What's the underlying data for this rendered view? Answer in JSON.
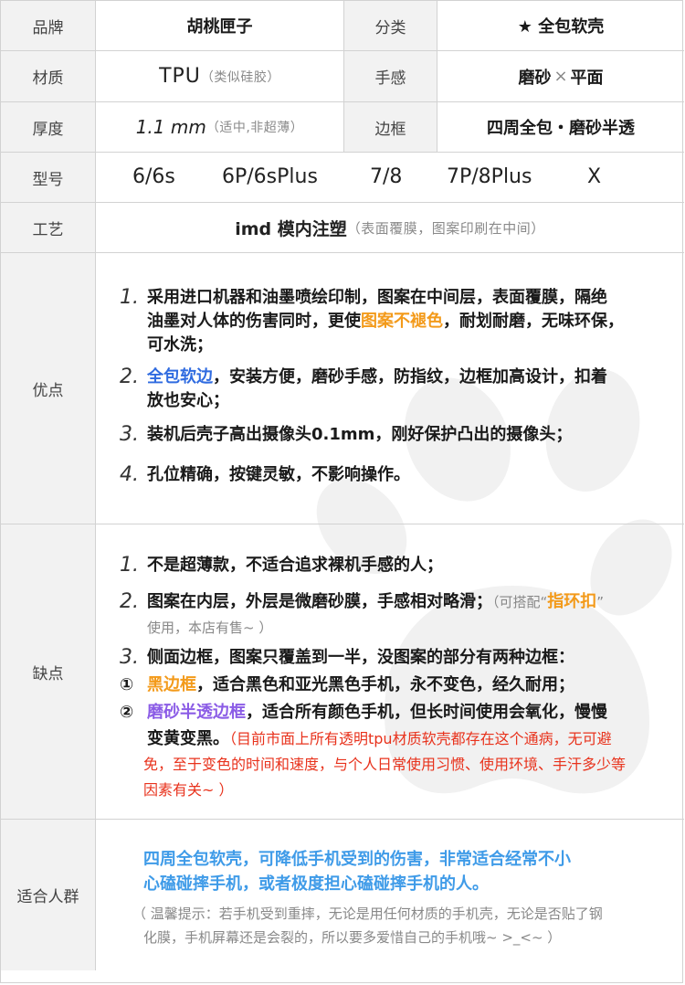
{
  "spec": {
    "brand": {
      "label": "品牌",
      "value": "胡桃匣子"
    },
    "category": {
      "label": "分类",
      "value": "★ 全包软壳"
    },
    "material": {
      "label": "材质",
      "value": "TPU",
      "note": "（类似硅胶）"
    },
    "feel": {
      "label": "手感",
      "value_a": "磨砂",
      "value_sep": "×",
      "value_b": "平面"
    },
    "thickness": {
      "label": "厚度",
      "value": "1.1 mm",
      "note": "（适中,非超薄）"
    },
    "frame": {
      "label": "边框",
      "value": "四周全包・磨砂半透"
    },
    "model": {
      "label": "型号",
      "items": [
        "6/6s",
        "6P/6sPlus",
        "7/8",
        "7P/8Plus",
        "X"
      ]
    },
    "craft": {
      "label": "工艺",
      "value": "imd 模内注塑",
      "note": "（表面覆膜，图案印刷在中间）"
    }
  },
  "pros": {
    "label": "优点",
    "items": [
      {
        "num": "1.",
        "l1": "采用进口机器和油墨喷绘印制，图案在中间层，表面覆膜，隔绝",
        "l2a": "油墨对人体的伤害同时，更使",
        "l2b": "图案不褪色",
        "l2c": "，耐划耐磨，无味环保，",
        "l3": "可水洗；"
      },
      {
        "num": "2.",
        "l1a": "全包软边",
        "l1b": "，安装方便，磨砂手感，防指纹，边框加高设计，扣着",
        "l2": "放也安心；"
      },
      {
        "num": "3.",
        "l1": "装机后壳子高出摄像头0.1mm，刚好保护凸出的摄像头；"
      },
      {
        "num": "4.",
        "l1": "孔位精确，按键灵敏，不影响操作。"
      }
    ]
  },
  "cons": {
    "label": "缺点",
    "item1": {
      "num": "1.",
      "text": "不是超薄款，不适合追求裸机手感的人；"
    },
    "item2": {
      "num": "2.",
      "text": "图案在内层，外层是微磨砂膜，手感相对略滑；",
      "note_a": "（可搭配“",
      "note_b": "指环扣",
      "note_c": "”",
      "note2": "使用，本店有售~ ）"
    },
    "item3": {
      "num": "3.",
      "text": "侧面边框，图案只覆盖到一半，没图案的部分有两种边框："
    },
    "sub1": {
      "num": "①",
      "name": "黑边框",
      "text": "，适合黑色和亚光黑色手机，永不变色，经久耐用；"
    },
    "sub2": {
      "num": "②",
      "name": "磨砂半透边框",
      "text": "，适合所有颜色手机，但长时间使用会氧化，慢慢",
      "l2a": "变黄变黑。",
      "l2b": "（目前市面上所有透明tpu材质软壳都存在这个通病，无可避",
      "l3": "免，至于变色的时间和速度，与个人日常使用习惯、使用环境、手汗多少等",
      "l4": "因素有关~ ）"
    }
  },
  "audience": {
    "label": "适合人群",
    "l1": "四周全包软壳，可降低手机受到的伤害，非常适合经常不小",
    "l2": "心磕碰摔手机，或者极度担心磕碰摔手机的人。",
    "tip1": "（ 温馨提示：若手机受到重摔，无论是用任何材质的手机壳，无论是否贴了钢",
    "tip2": "化膜，手机屏幕还是会裂的，所以要多爱惜自己的手机哦~ >_<~ ）"
  },
  "colors": {
    "orange": "#f39a1a",
    "blue": "#2f6be0",
    "purple": "#8b5ce6",
    "red": "#e8321c",
    "sky": "#3f9be8",
    "label_bg": "#f2f2f2",
    "border": "#d2d2d2"
  }
}
